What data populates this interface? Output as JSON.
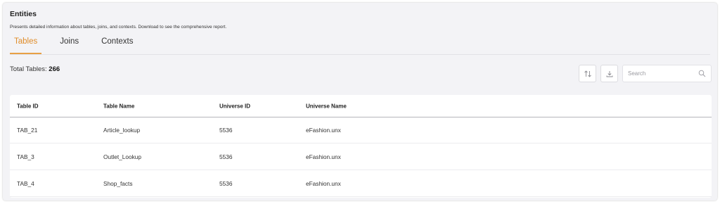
{
  "header": {
    "title": "Entities",
    "subtitle": "Presents detailed information about tables, joins, and contexts. Download to see the comprehensive report."
  },
  "tabs": [
    {
      "label": "Tables",
      "active": true
    },
    {
      "label": "Joins",
      "active": false
    },
    {
      "label": "Contexts",
      "active": false
    }
  ],
  "summary": {
    "label": "Total Tables:",
    "count": "266"
  },
  "toolbar": {
    "sort_icon": "sort-arrows-icon",
    "download_icon": "download-icon"
  },
  "search": {
    "placeholder": "Search",
    "value": "",
    "icon": "search-icon"
  },
  "table": {
    "columns": [
      "Table ID",
      "Table Name",
      "Universe ID",
      "Universe Name"
    ],
    "rows": [
      [
        "TAB_21",
        "Article_lookup",
        "5536",
        "eFashion.unx"
      ],
      [
        "TAB_3",
        "Outlet_Lookup",
        "5536",
        "eFashion.unx"
      ],
      [
        "TAB_4",
        "Shop_facts",
        "5536",
        "eFashion.unx"
      ]
    ]
  },
  "colors": {
    "accent": "#e8a045",
    "panel_bg": "#f3f3f6"
  }
}
